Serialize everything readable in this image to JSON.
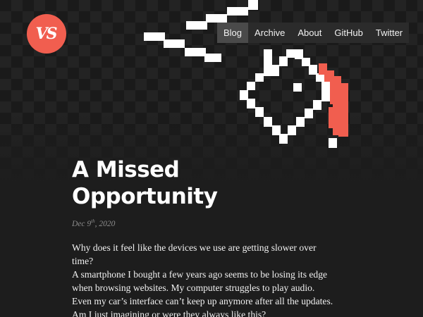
{
  "site": {
    "logo_text": "VS",
    "brand_color": "#f15e4f",
    "background": "#1d1d1d"
  },
  "nav": {
    "items": [
      {
        "label": "Blog",
        "active": true
      },
      {
        "label": "Archive",
        "active": false
      },
      {
        "label": "About",
        "active": false
      },
      {
        "label": "GitHub",
        "active": false
      },
      {
        "label": "Twitter",
        "active": false
      }
    ]
  },
  "header_art": {
    "icon": "pixel-paint-bucket-icon",
    "colors": [
      "#ffffff",
      "#f15e4f"
    ]
  },
  "post": {
    "title_line1": "A Missed",
    "title_line2": "Opportunity",
    "date_prefix": "Dec 9",
    "date_suffix": "th",
    "date_year": ", 2020",
    "body_line1": "Why does it feel like the devices we use are getting slower over time?",
    "body_rest": "A smartphone I bought a few years ago seems to be losing its edge when browsing websites. My computer struggles to play audio. Even my car’s interface can’t keep up anymore after all the updates. Am I just imagining or were they always like this?"
  }
}
